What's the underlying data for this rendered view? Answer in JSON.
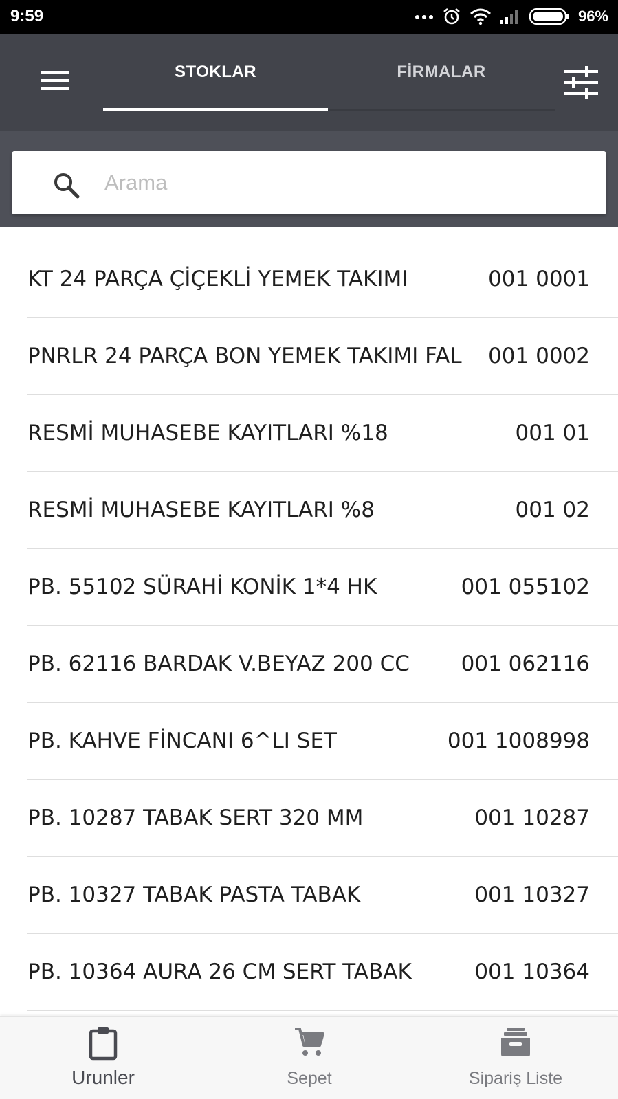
{
  "status_bar": {
    "time": "9:59",
    "battery": "96%"
  },
  "tabs": {
    "stoklar": "STOKLAR",
    "firmalar": "FİRMALAR",
    "active": "stoklar"
  },
  "search": {
    "placeholder": "Arama",
    "value": ""
  },
  "items": [
    {
      "name": "KT 24 PARÇA ÇİÇEKLİ YEMEK TAKIMI",
      "code": "001 0001"
    },
    {
      "name": "PNRLR 24 PARÇA BON YEMEK TAKIMI FAL",
      "code": "001 0002"
    },
    {
      "name": "RESMİ MUHASEBE KAYITLARI %18",
      "code": "001 01"
    },
    {
      "name": "RESMİ MUHASEBE KAYITLARI %8",
      "code": "001 02"
    },
    {
      "name": "PB. 55102 SÜRAHİ KONİK 1*4 HK",
      "code": "001 055102"
    },
    {
      "name": "PB. 62116 BARDAK V.BEYAZ 200 CC",
      "code": "001 062116"
    },
    {
      "name": "PB. KAHVE FİNCANI 6^LI SET",
      "code": "001 1008998"
    },
    {
      "name": "PB. 10287 TABAK SERT 320 MM",
      "code": "001 10287"
    },
    {
      "name": "PB. 10327 TABAK PASTA TABAK",
      "code": "001 10327"
    },
    {
      "name": "PB. 10364 AURA 26 CM SERT TABAK",
      "code": "001 10364"
    },
    {
      "name": "",
      "code": ""
    }
  ],
  "bottom_nav": {
    "urunler": "Urunler",
    "sepet": "Sepet",
    "siparis_liste": "Sipariş Liste",
    "active": "urunler"
  },
  "colors": {
    "app_bar": "#42444b",
    "search_band": "#4e5058",
    "divider": "#dedede",
    "nav_active": "#4a4b52",
    "nav_inactive": "#7a7b80"
  },
  "icons": [
    "menu-icon",
    "sliders-icon",
    "search-icon",
    "clipboard-icon",
    "cart-icon",
    "archive-box-icon",
    "alarm-icon",
    "wifi-icon",
    "signal-icon",
    "battery-icon"
  ]
}
